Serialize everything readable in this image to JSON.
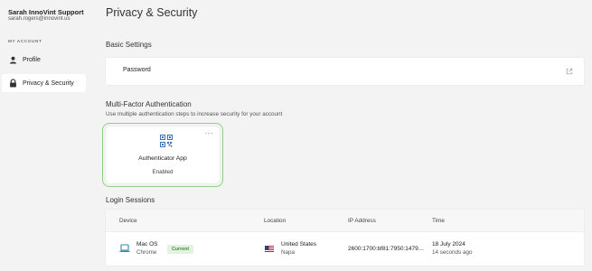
{
  "sidebar": {
    "user_name": "Sarah InnoVint Support",
    "user_email": "sarah.rogers@innovint.us",
    "section_label": "MY ACCOUNT",
    "items": [
      {
        "label": "Profile",
        "icon": "person-icon",
        "active": false
      },
      {
        "label": "Privacy & Security",
        "icon": "lock-icon",
        "active": true
      }
    ]
  },
  "main": {
    "title": "Privacy & Security",
    "basic_settings": {
      "heading": "Basic Settings",
      "password_label": "Password",
      "password_icon": "external-link-icon"
    },
    "mfa": {
      "heading": "Multi-Factor Authentication",
      "subtitle": "Use multiple authentication steps to increase security for your account",
      "card": {
        "icon": "qr-code-icon",
        "title": "Authenticator App",
        "status": "Enabled",
        "menu": "···",
        "border_color": "#8fcf86"
      }
    },
    "login_sessions": {
      "heading": "Login Sessions",
      "columns": [
        "Device",
        "Location",
        "IP Address",
        "Time"
      ],
      "rows": [
        {
          "device_os": "Mac OS",
          "device_browser": "Chrome",
          "badge": "Current",
          "location_city": "United States",
          "location_region": "Napa",
          "ip": "2600:1700:bf81:7950:1479…",
          "time_date": "18 July 2024",
          "time_ago": "14 seconds ago"
        }
      ]
    }
  },
  "colors": {
    "accent_green": "#8fcf86",
    "badge_text": "#3c8f35",
    "badge_bg": "#e3f3df",
    "icon_teal": "#2d8aa0",
    "qr_blue": "#3c6fb4"
  }
}
